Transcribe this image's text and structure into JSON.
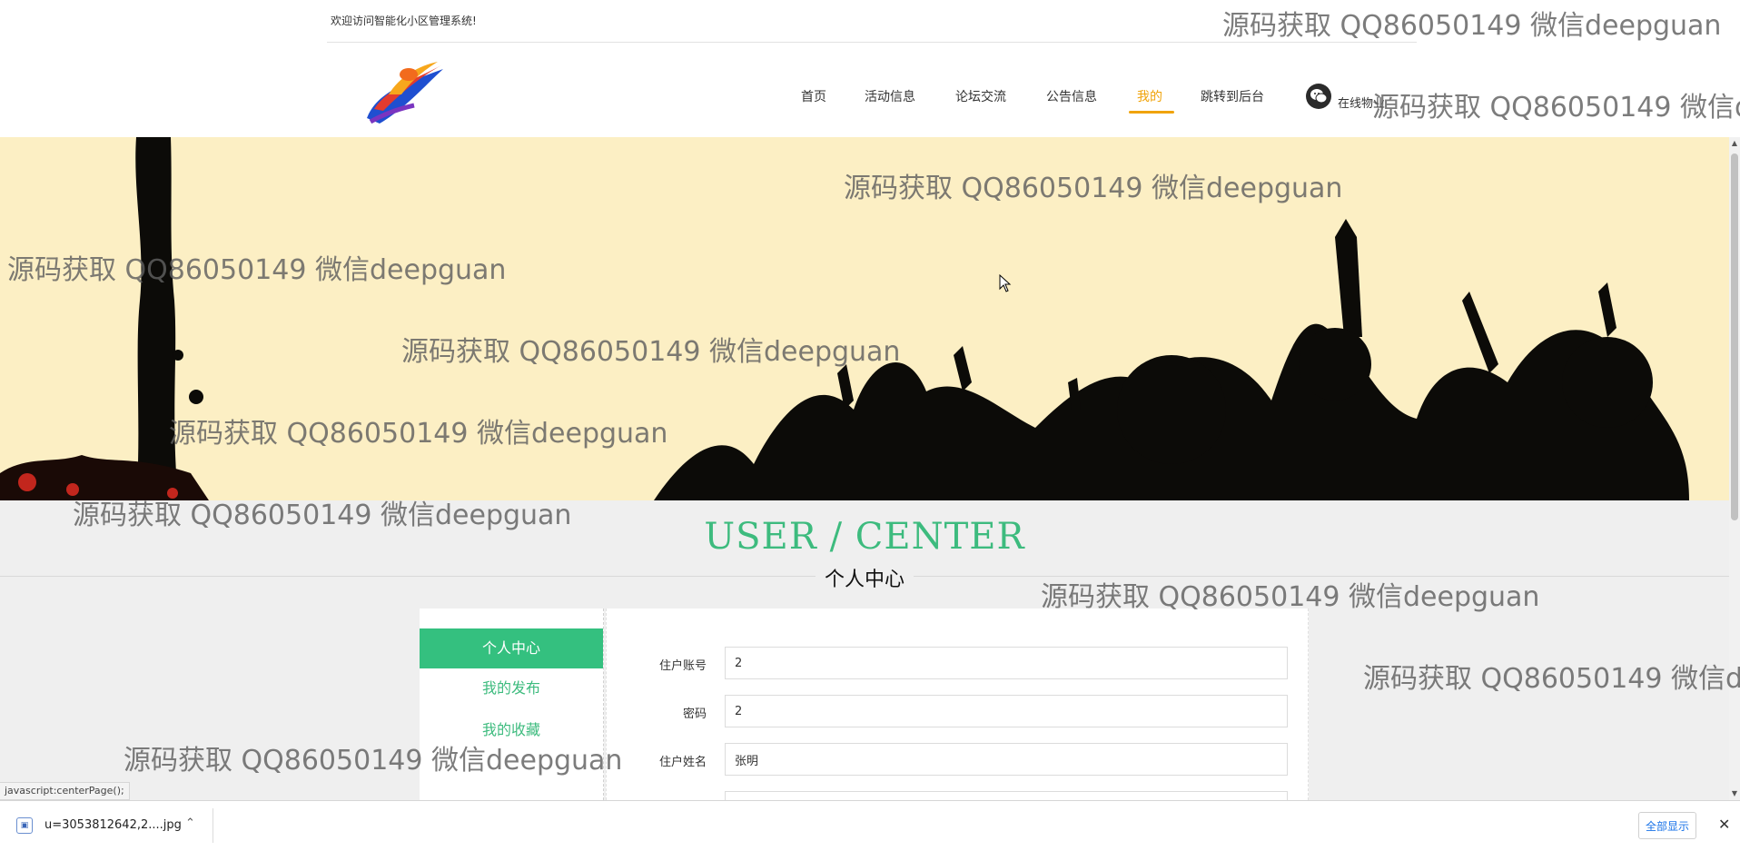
{
  "header": {
    "welcome_text": "欢迎访问智能化小区管理系统!",
    "online_label": "在线物业"
  },
  "nav": {
    "items": [
      {
        "label": "首页",
        "active": false
      },
      {
        "label": "活动信息",
        "active": false
      },
      {
        "label": "论坛交流",
        "active": false
      },
      {
        "label": "公告信息",
        "active": false
      },
      {
        "label": "我的",
        "active": true
      },
      {
        "label": "跳转到后台",
        "active": false
      }
    ]
  },
  "section": {
    "title_en": "USER / CENTER",
    "title_cn": "个人中心"
  },
  "sidebar": {
    "items": [
      {
        "label": "个人中心",
        "active": true
      },
      {
        "label": "我的发布",
        "active": false
      },
      {
        "label": "我的收藏",
        "active": false
      }
    ]
  },
  "form": {
    "fields": [
      {
        "label": "住户账号",
        "value": "2"
      },
      {
        "label": "密码",
        "value": "2"
      },
      {
        "label": "住户姓名",
        "value": "张明"
      }
    ]
  },
  "status_bar": {
    "link_text": "javascript:centerPage();"
  },
  "download_bar": {
    "filename": "u=3053812642,2....jpg",
    "show_all_label": "全部显示"
  },
  "watermark": {
    "text": "源码获取 QQ86050149 微信deepguan"
  },
  "colors": {
    "accent_green": "#34c07f",
    "nav_active": "#f0a30a",
    "banner_bg": "#fcefc4",
    "content_bg": "#efefef"
  },
  "icons": {
    "logo": "brand-logo",
    "wechat": "wechat-icon",
    "download_file": "image-file-icon",
    "chevron": "chevron-up-icon",
    "close": "close-icon"
  }
}
